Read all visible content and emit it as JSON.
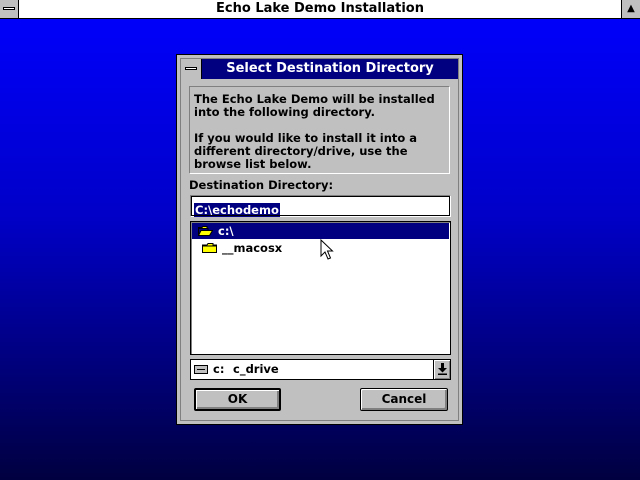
{
  "window": {
    "title": "Echo Lake Demo Installation"
  },
  "dialog": {
    "title": "Select Destination Directory",
    "info_line1": "The Echo Lake Demo will be installed into the following directory.",
    "info_line2": "If you would like to install it into a different directory/drive, use the browse list below.",
    "dest_label": "Destination Directory:",
    "dest_value": "C:\\echodemo",
    "directories": [
      {
        "name": "c:\\",
        "icon": "open-folder-icon",
        "selected": true
      },
      {
        "name": "__macosx",
        "icon": "folder-icon",
        "selected": false
      }
    ],
    "drive": {
      "letter": "c:",
      "label": "c_drive",
      "icon": "drive-icon"
    },
    "ok_label": "OK",
    "cancel_label": "Cancel"
  },
  "colors": {
    "desktop_top": "#0000ff",
    "desktop_bottom": "#000040",
    "titlebar_active": "#000080",
    "dialog_face": "#c0c0c0",
    "selection": "#000080"
  }
}
